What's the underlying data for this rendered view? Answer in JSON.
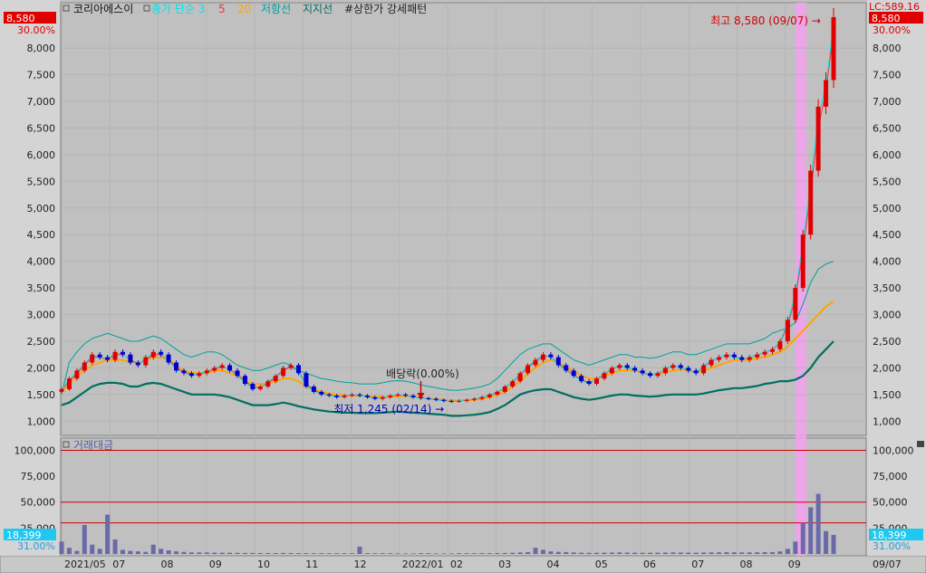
{
  "chart_data": [
    {
      "type": "candlestick",
      "stock_name": "코리아에스이",
      "legend": [
        {
          "text": "종가 단순 3",
          "color": "#00e5ee"
        },
        {
          "text": "5",
          "color": "#ff3030"
        },
        {
          "text": "20",
          "color": "#ffa500"
        },
        {
          "text": "저항선",
          "color": "#00a0a0"
        },
        {
          "text": "지지선",
          "color": "#007060"
        },
        {
          "text": "#상한가 강세패턴",
          "color": "#222222"
        }
      ],
      "y_ticks": [
        "8,000",
        "7,500",
        "7,000",
        "6,500",
        "6,000",
        "5,500",
        "5,000",
        "4,500",
        "4,000",
        "3,500",
        "3,000",
        "2,500",
        "2,000",
        "1,500",
        "1,000"
      ],
      "y_tick_values": [
        8000,
        7500,
        7000,
        6500,
        6000,
        5500,
        5000,
        4500,
        4000,
        3500,
        3000,
        2500,
        2000,
        1500,
        1000
      ],
      "ylim": [
        750,
        8800
      ],
      "x_labels": [
        "2021/05",
        "07",
        "08",
        "09",
        "10",
        "11",
        "12",
        "2022/01",
        "02",
        "03",
        "04",
        "05",
        "06",
        "07",
        "08",
        "09"
      ],
      "last_price_label": "8,580",
      "last_pct_label": "30.00%",
      "lc_label": "LC:589.16",
      "high_annotation": "최고 8,580 (09/07)",
      "low_annotation": "최저 1,245 (02/14)",
      "dividend_annotation": "배당락(0.00%)",
      "close_series": [
        1600,
        1800,
        1950,
        2100,
        2250,
        2200,
        2150,
        2300,
        2250,
        2100,
        2050,
        2200,
        2300,
        2250,
        2100,
        1950,
        1900,
        1850,
        1900,
        1950,
        2000,
        2050,
        1950,
        1850,
        1700,
        1600,
        1650,
        1750,
        1850,
        2000,
        2050,
        1900,
        1650,
        1550,
        1500,
        1480,
        1450,
        1480,
        1500,
        1480,
        1450,
        1420,
        1450,
        1480,
        1500,
        1480,
        1450,
        1430,
        1420,
        1400,
        1380,
        1370,
        1380,
        1400,
        1420,
        1450,
        1500,
        1550,
        1650,
        1750,
        1900,
        2050,
        2150,
        2250,
        2200,
        2050,
        1950,
        1850,
        1750,
        1700,
        1800,
        1900,
        2000,
        2050,
        2000,
        1950,
        1900,
        1850,
        1900,
        2000,
        2050,
        2000,
        1950,
        1900,
        2050,
        2150,
        2200,
        2250,
        2200,
        2150,
        2200,
        2250,
        2300,
        2350,
        2500,
        2900,
        3500,
        4500,
        5700,
        6900,
        7400,
        8580
      ],
      "resist_series": [
        1500,
        2100,
        2300,
        2450,
        2550,
        2600,
        2650,
        2600,
        2550,
        2500,
        2500,
        2550,
        2600,
        2550,
        2450,
        2350,
        2250,
        2200,
        2250,
        2300,
        2300,
        2250,
        2150,
        2050,
        2000,
        1950,
        1950,
        2000,
        2050,
        2100,
        2050,
        1950,
        1900,
        1850,
        1800,
        1780,
        1750,
        1730,
        1720,
        1700,
        1700,
        1700,
        1720,
        1750,
        1760,
        1750,
        1720,
        1680,
        1650,
        1630,
        1600,
        1580,
        1580,
        1600,
        1620,
        1650,
        1700,
        1800,
        1950,
        2100,
        2250,
        2350,
        2400,
        2450,
        2450,
        2350,
        2250,
        2150,
        2100,
        2050,
        2100,
        2150,
        2200,
        2250,
        2250,
        2200,
        2200,
        2180,
        2200,
        2250,
        2300,
        2300,
        2250,
        2250,
        2300,
        2350,
        2400,
        2450,
        2450,
        2450,
        2450,
        2500,
        2550,
        2650,
        2700,
        2750,
        2850,
        3200,
        3600,
        3850,
        3950,
        4000
      ],
      "support_series": [
        1300,
        1350,
        1450,
        1550,
        1650,
        1700,
        1720,
        1720,
        1700,
        1650,
        1650,
        1700,
        1720,
        1700,
        1650,
        1600,
        1550,
        1500,
        1500,
        1500,
        1500,
        1480,
        1450,
        1400,
        1350,
        1300,
        1300,
        1300,
        1320,
        1350,
        1320,
        1280,
        1250,
        1220,
        1200,
        1180,
        1170,
        1160,
        1160,
        1150,
        1150,
        1150,
        1160,
        1170,
        1180,
        1170,
        1160,
        1150,
        1140,
        1130,
        1120,
        1100,
        1100,
        1110,
        1120,
        1140,
        1170,
        1230,
        1300,
        1400,
        1500,
        1550,
        1580,
        1600,
        1600,
        1550,
        1500,
        1450,
        1420,
        1400,
        1420,
        1450,
        1480,
        1500,
        1500,
        1480,
        1470,
        1460,
        1470,
        1490,
        1500,
        1500,
        1500,
        1500,
        1520,
        1550,
        1580,
        1600,
        1620,
        1620,
        1640,
        1660,
        1700,
        1720,
        1750,
        1750,
        1780,
        1850,
        2000,
        2200,
        2350,
        2500
      ],
      "ma20_series": [
        1550,
        1700,
        1850,
        1950,
        2050,
        2100,
        2150,
        2150,
        2150,
        2100,
        2100,
        2150,
        2200,
        2200,
        2150,
        2050,
        1950,
        1900,
        1900,
        1900,
        1950,
        1950,
        1900,
        1850,
        1750,
        1700,
        1700,
        1700,
        1750,
        1800,
        1800,
        1750,
        1650,
        1600,
        1550,
        1520,
        1500,
        1480,
        1480,
        1480,
        1470,
        1450,
        1450,
        1460,
        1470,
        1470,
        1460,
        1440,
        1430,
        1420,
        1400,
        1390,
        1390,
        1390,
        1400,
        1420,
        1450,
        1500,
        1550,
        1650,
        1750,
        1900,
        2000,
        2100,
        2150,
        2100,
        2000,
        1950,
        1850,
        1800,
        1800,
        1850,
        1900,
        1950,
        1950,
        1950,
        1900,
        1880,
        1880,
        1920,
        1950,
        1970,
        1950,
        1920,
        1950,
        2000,
        2050,
        2100,
        2150,
        2150,
        2150,
        2180,
        2200,
        2250,
        2300,
        2400,
        2550,
        2700,
        2850,
        3000,
        3150,
        3250
      ],
      "ma5_series": [
        1580,
        1750,
        1900,
        2050,
        2200,
        2200,
        2150,
        2250,
        2250,
        2150,
        2080,
        2150,
        2250,
        2250,
        2150,
        2000,
        1920,
        1870,
        1880,
        1930,
        1980,
        2020,
        1970,
        1880,
        1750,
        1640,
        1640,
        1720,
        1820,
        1950,
        2020,
        1930,
        1700,
        1580,
        1520,
        1490,
        1460,
        1470,
        1490,
        1480,
        1460,
        1430,
        1440,
        1470,
        1490,
        1480,
        1460,
        1440,
        1420,
        1400,
        1385,
        1372,
        1378,
        1395,
        1415,
        1445,
        1490,
        1540,
        1630,
        1730,
        1870,
        2010,
        2120,
        2220,
        2210,
        2080,
        1970,
        1870,
        1780,
        1720,
        1780,
        1880,
        1980,
        2040,
        2010,
        1960,
        1910,
        1860,
        1890,
        1980,
        2040,
        2010,
        1960,
        1910,
        2020,
        2130,
        2190,
        2240,
        2210,
        2160,
        2190,
        2240,
        2290,
        2340,
        2470,
        2800,
        3300,
        4200,
        5300,
        6500,
        7200,
        8300
      ],
      "ma3_series": [
        1590,
        1780,
        1930,
        2080,
        2230,
        2210,
        2160,
        2280,
        2260,
        2130,
        2060,
        2180,
        2280,
        2260,
        2130,
        1970,
        1910,
        1860,
        1890,
        1940,
        1990,
        2040,
        1960,
        1860,
        1720,
        1620,
        1640,
        1740,
        1840,
        1980,
        2040,
        1920,
        1670,
        1560,
        1510,
        1485,
        1455,
        1475,
        1495,
        1482,
        1455,
        1425,
        1445,
        1475,
        1495,
        1482,
        1455,
        1435,
        1422,
        1402,
        1382,
        1370,
        1378,
        1398,
        1418,
        1448,
        1495,
        1545,
        1640,
        1740,
        1890,
        2030,
        2140,
        2240,
        2205,
        2060,
        1955,
        1855,
        1760,
        1705,
        1790,
        1890,
        1990,
        2045,
        2005,
        1955,
        1905,
        1855,
        1895,
        1990,
        2045,
        2005,
        1955,
        1905,
        2035,
        2140,
        2195,
        2245,
        2205,
        2155,
        2195,
        2245,
        2295,
        2345,
        2490,
        2850,
        3400,
        4350,
        5500,
        6700,
        7300,
        8450
      ],
      "volume_panel": {
        "title": "거래대금",
        "y_ticks": [
          "100,000",
          "75,000",
          "50,000",
          "25,000"
        ],
        "y_tick_values": [
          100000,
          75000,
          50000,
          25000
        ],
        "ylim": [
          0,
          110000
        ],
        "ref_lines": [
          100000,
          50000,
          30000
        ],
        "last_value_label": "18,399",
        "last_pct_label": "31.00%",
        "volumes": [
          12000,
          6000,
          3000,
          28000,
          9000,
          5000,
          38000,
          14000,
          4000,
          3000,
          2500,
          2000,
          9000,
          5000,
          3500,
          2500,
          2000,
          1500,
          1500,
          1500,
          1300,
          1200,
          1200,
          1100,
          1000,
          1000,
          900,
          900,
          900,
          1000,
          900,
          800,
          800,
          700,
          700,
          700,
          700,
          700,
          700,
          7000,
          800,
          700,
          700,
          700,
          600,
          600,
          600,
          700,
          700,
          600,
          600,
          600,
          700,
          700,
          700,
          800,
          800,
          900,
          1000,
          1200,
          1500,
          1800,
          6000,
          4000,
          2500,
          2000,
          1800,
          1500,
          1300,
          1200,
          1200,
          1300,
          1400,
          1500,
          1400,
          1300,
          1200,
          1200,
          1300,
          1400,
          1500,
          1400,
          1300,
          1300,
          1400,
          1500,
          1600,
          1700,
          1600,
          1500,
          1500,
          1600,
          1700,
          1800,
          2500,
          5000,
          12000,
          30000,
          45000,
          58000,
          22000,
          18399
        ]
      }
    }
  ]
}
